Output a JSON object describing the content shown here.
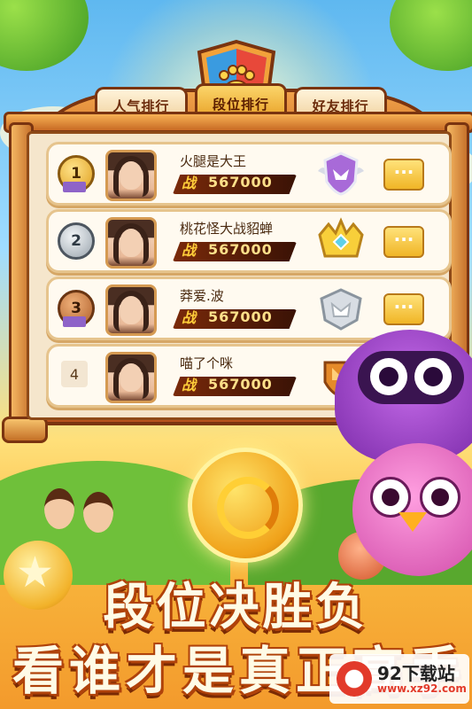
{
  "tabs": [
    {
      "label": "人气排行",
      "active": false
    },
    {
      "label": "段位排行",
      "active": true
    },
    {
      "label": "好友排行",
      "active": false
    }
  ],
  "leaderboard": [
    {
      "rank": "1",
      "medal": "gold",
      "name": "火腿是大王",
      "score_tag": "战",
      "score": "567000",
      "badge": "purple-winged-badge-icon"
    },
    {
      "rank": "2",
      "medal": "silver",
      "name": "桃花怪大战貂蝉",
      "score_tag": "战",
      "score": "567000",
      "badge": "gold-crown-badge-icon"
    },
    {
      "rank": "3",
      "medal": "bronze",
      "name": "莽爱.波",
      "score_tag": "战",
      "score": "567000",
      "badge": "silver-badge-icon"
    },
    {
      "rank": "4",
      "medal": "none",
      "name": "喵了个咪",
      "score_tag": "战",
      "score": "567000",
      "badge": "bronze-badge-icon"
    }
  ],
  "banner": {
    "line1": "段位决胜负",
    "line2": "看谁才是真正高手"
  },
  "watermark": {
    "name": "92下载站",
    "url": "www.xz92.com"
  },
  "colors": {
    "wood": "#c8641e",
    "row_bg": "#fffaf0",
    "score_text": "#ffe08a",
    "title_stroke": "#b0420a"
  }
}
